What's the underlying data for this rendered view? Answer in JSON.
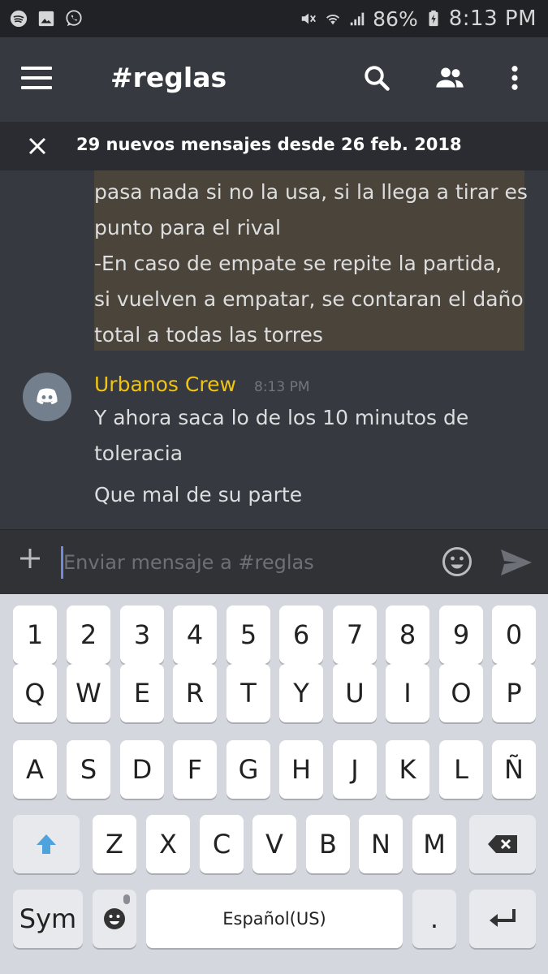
{
  "status_bar": {
    "left_icons": [
      "spotify-icon",
      "gallery-icon",
      "whatsapp-icon"
    ],
    "right_icons": [
      "mute-icon",
      "wifi-icon",
      "signal-icon",
      "battery-icon"
    ],
    "battery": "86%",
    "time": "8:13 PM"
  },
  "toolbar": {
    "menu_icon": "hamburger-icon",
    "channel": "#reglas",
    "icons": [
      "search-icon",
      "members-icon",
      "more-vert-icon"
    ]
  },
  "new_messages_bar": {
    "close_icon": "close-icon",
    "text": "29 nuevos mensajes desde 26 feb. 2018"
  },
  "messages": {
    "previous_message_lines": [
      "pasa nada si no la usa, si la llega a tirar es",
      "punto para el rival",
      "-En caso de empate se repite la partida,",
      "si vuelven a empatar, se contaran el daño",
      "total a todas las torres"
    ],
    "latest": {
      "author": "Urbanos Crew",
      "timestamp": "8:13 PM",
      "lines": [
        "Y ahora saca lo de los 10 minutos de",
        "toleracia"
      ],
      "followup": "Que mal de su parte"
    }
  },
  "input": {
    "placeholder": "Enviar mensaje a #reglas",
    "value": ""
  },
  "keyboard": {
    "row_numbers": [
      "1",
      "2",
      "3",
      "4",
      "5",
      "6",
      "7",
      "8",
      "9",
      "0"
    ],
    "row_top": [
      "Q",
      "W",
      "E",
      "R",
      "T",
      "Y",
      "U",
      "I",
      "O",
      "P"
    ],
    "row_home": [
      "A",
      "S",
      "D",
      "F",
      "G",
      "H",
      "J",
      "K",
      "L",
      "Ñ"
    ],
    "row_bottom": [
      "Z",
      "X",
      "C",
      "V",
      "B",
      "N",
      "M"
    ],
    "sym": "Sym",
    "space": "Español(US)",
    "period": ".",
    "colors": {
      "shift_arrow": "#4fa3dc"
    }
  },
  "colors": {
    "author": "#f1c40f",
    "highlight": "#4b443a",
    "background": "#36393f"
  }
}
